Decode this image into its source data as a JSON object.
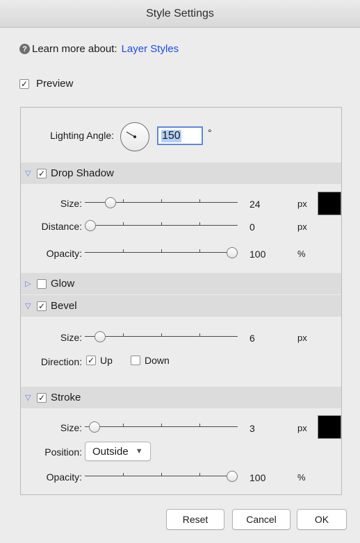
{
  "window": {
    "title": "Style Settings"
  },
  "help": {
    "prefix": "Learn more about:",
    "link": "Layer Styles",
    "icon": "help-icon"
  },
  "preview": {
    "label": "Preview",
    "checked": true
  },
  "lighting": {
    "label": "Lighting Angle:",
    "angle": "150",
    "degree": "°"
  },
  "drop_shadow": {
    "title": "Drop Shadow",
    "expanded": true,
    "checked": true,
    "size": {
      "label": "Size:",
      "value": "24",
      "unit": "px",
      "fraction": 0.14
    },
    "distance": {
      "label": "Distance:",
      "value": "0",
      "unit": "px",
      "fraction": 0.0
    },
    "opacity": {
      "label": "Opacity:",
      "value": "100",
      "unit": "%",
      "fraction": 1.0
    },
    "color": "#000000"
  },
  "glow": {
    "title": "Glow",
    "expanded": false,
    "checked": false
  },
  "bevel": {
    "title": "Bevel",
    "expanded": true,
    "checked": true,
    "size": {
      "label": "Size:",
      "value": "6",
      "unit": "px",
      "fraction": 0.07
    },
    "direction": {
      "label": "Direction:",
      "up": "Up",
      "down": "Down",
      "up_checked": true,
      "down_checked": false
    }
  },
  "stroke": {
    "title": "Stroke",
    "expanded": true,
    "checked": true,
    "size": {
      "label": "Size:",
      "value": "3",
      "unit": "px",
      "fraction": 0.03
    },
    "position": {
      "label": "Position:",
      "selected": "Outside"
    },
    "opacity": {
      "label": "Opacity:",
      "value": "100",
      "unit": "%",
      "fraction": 1.0
    },
    "color": "#000000"
  },
  "buttons": {
    "reset": "Reset",
    "cancel": "Cancel",
    "ok": "OK"
  }
}
